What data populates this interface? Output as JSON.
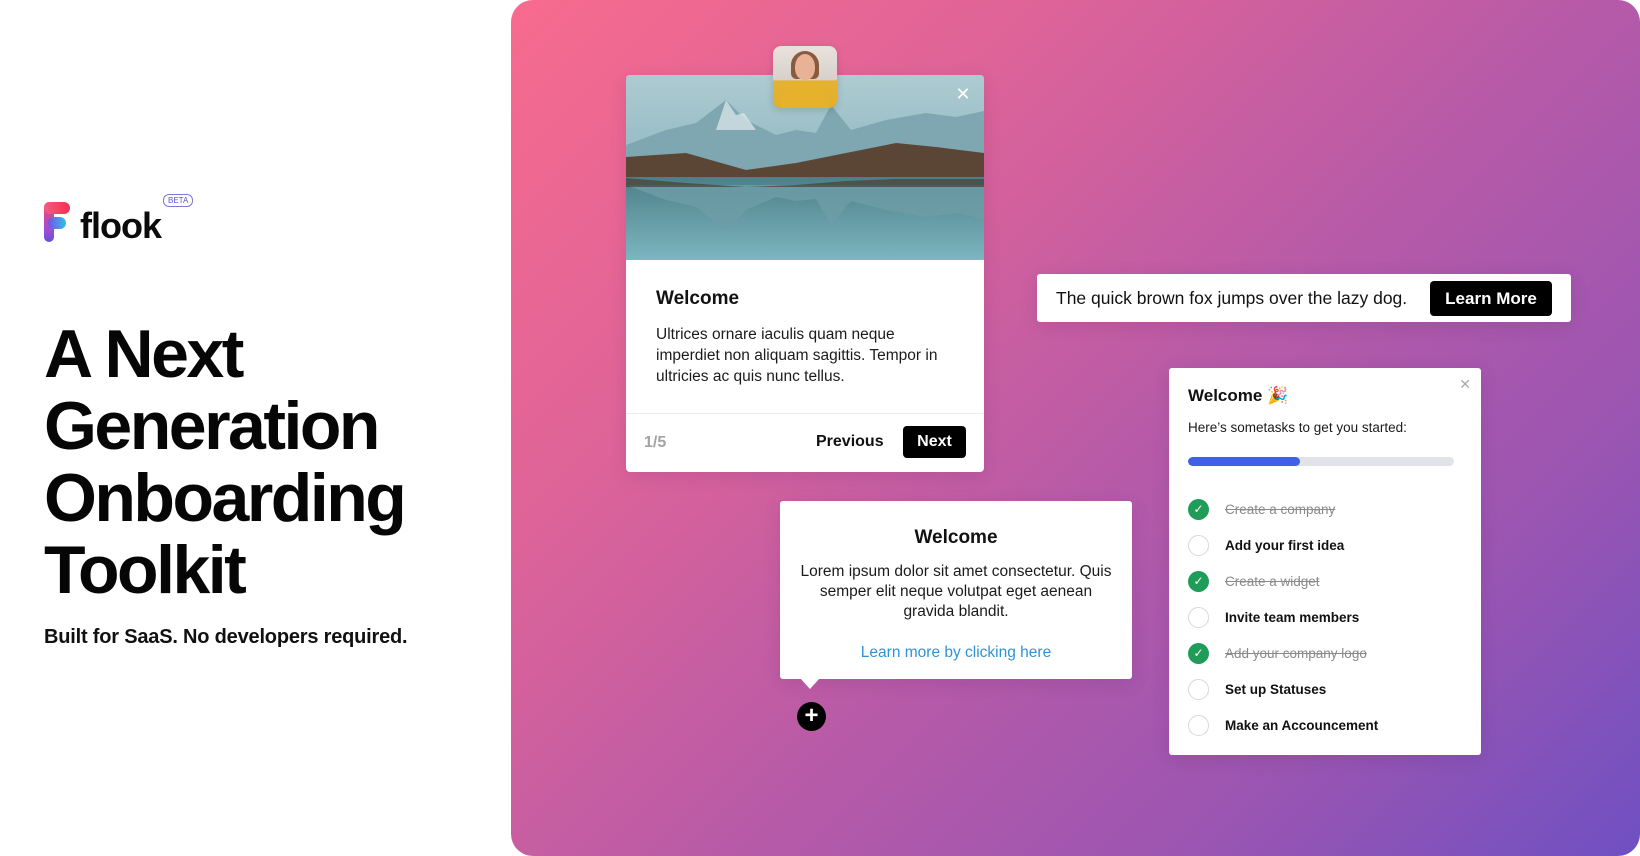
{
  "brand": {
    "name": "flook",
    "badge": "BETA"
  },
  "hero": {
    "headline_lines": [
      "A Next",
      "Generation",
      "Onboarding",
      "Toolkit"
    ],
    "subheadline": "Built for SaaS. No developers required."
  },
  "colors": {
    "gradient_start": "#f76b8e",
    "gradient_end": "#6f50c2",
    "progress_fill": "#3e61e6",
    "check_done": "#1f9c57",
    "link": "#2e93d6"
  },
  "tour_card": {
    "title": "Welcome",
    "body": "Ultrices ornare iaculis quam neque imperdiet non aliquam sagittis. Tempor in ultricies ac quis nunc tellus.",
    "step_indicator": "1/5",
    "previous_label": "Previous",
    "next_label": "Next",
    "close_icon": "close-icon",
    "image": "mountain-lake-photo",
    "avatar": "woman-avatar-photo"
  },
  "banner": {
    "text": "The quick brown fox jumps over the lazy dog.",
    "button_label": "Learn More"
  },
  "tooltip": {
    "title": "Welcome",
    "body": "Lorem ipsum dolor sit amet consectetur. Quis semper elit neque volutpat eget aenean gravida blandit.",
    "link_label": "Learn more by clicking here",
    "hotspot_icon": "plus-icon"
  },
  "checklist": {
    "title": "Welcome",
    "title_emoji": "🎉",
    "subtitle": "Here’s sometasks to get you started:",
    "progress": 0.42,
    "items": [
      {
        "label": "Create a company",
        "done": true
      },
      {
        "label": "Add your first idea",
        "done": false
      },
      {
        "label": "Create a widget",
        "done": true
      },
      {
        "label": "Invite team members",
        "done": false
      },
      {
        "label": "Add your company logo",
        "done": true
      },
      {
        "label": "Set up Statuses",
        "done": false
      },
      {
        "label": "Make an Accouncement",
        "done": false
      }
    ]
  }
}
